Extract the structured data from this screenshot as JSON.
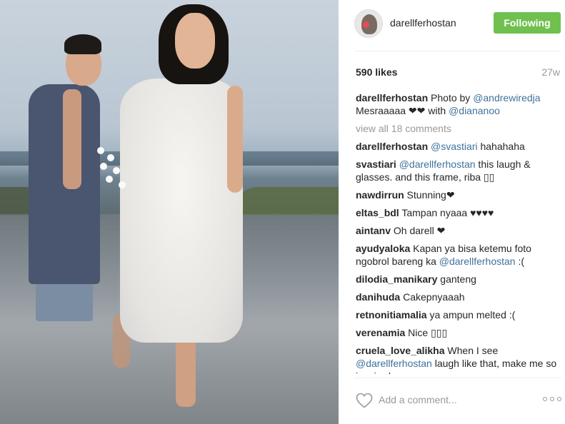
{
  "post": {
    "username": "darellferhostan",
    "follow_label": "Following",
    "likes": "590 likes",
    "age": "27w"
  },
  "caption": {
    "user": "darellferhostan",
    "text_1": " Photo by ",
    "mention_1": "@andrewiredja",
    "text_2": " Mesraaaaa ❤❤ with ",
    "mention_2": "@diananoo"
  },
  "view_all_label": "view all 18 comments",
  "comments": [
    {
      "user": "darellferhostan",
      "pre": " ",
      "mention": "@svastiari",
      "post": " hahahaha"
    },
    {
      "user": "svastiari",
      "pre": " ",
      "mention": "@darellferhostan",
      "post": " this laugh & glasses. and this frame, riba ▯▯"
    },
    {
      "user": "nawdirrun",
      "pre": " Stunning❤",
      "mention": "",
      "post": ""
    },
    {
      "user": "eltas_bdl",
      "pre": " Tampan nyaaa ♥♥♥♥",
      "mention": "",
      "post": ""
    },
    {
      "user": "aintanv",
      "pre": " Oh darell ❤",
      "mention": "",
      "post": ""
    },
    {
      "user": "ayudyaloka",
      "pre": " Kapan ya bisa ketemu foto ngobrol bareng ka ",
      "mention": "@darellferhostan",
      "post": " :("
    },
    {
      "user": "dilodia_manikary",
      "pre": " ganteng",
      "mention": "",
      "post": ""
    },
    {
      "user": "danihuda",
      "pre": " Cakepnyaaah",
      "mention": "",
      "post": ""
    },
    {
      "user": "retnonitiamalia",
      "pre": " ya ampun melted :(",
      "mention": "",
      "post": ""
    },
    {
      "user": "verenamia",
      "pre": " Nice ▯▯▯",
      "mention": "",
      "post": ""
    },
    {
      "user": "cruela_love_alikha",
      "pre": " When I see ",
      "mention": "@darellferhostan",
      "post": " laugh like that, make me so inspired"
    }
  ],
  "add_comment_placeholder": "Add a comment...",
  "icons": {
    "like": "heart-icon",
    "more": "more-options-icon"
  },
  "colors": {
    "follow_button": "#70c050",
    "mention": "#3f729b",
    "muted": "#999999"
  }
}
